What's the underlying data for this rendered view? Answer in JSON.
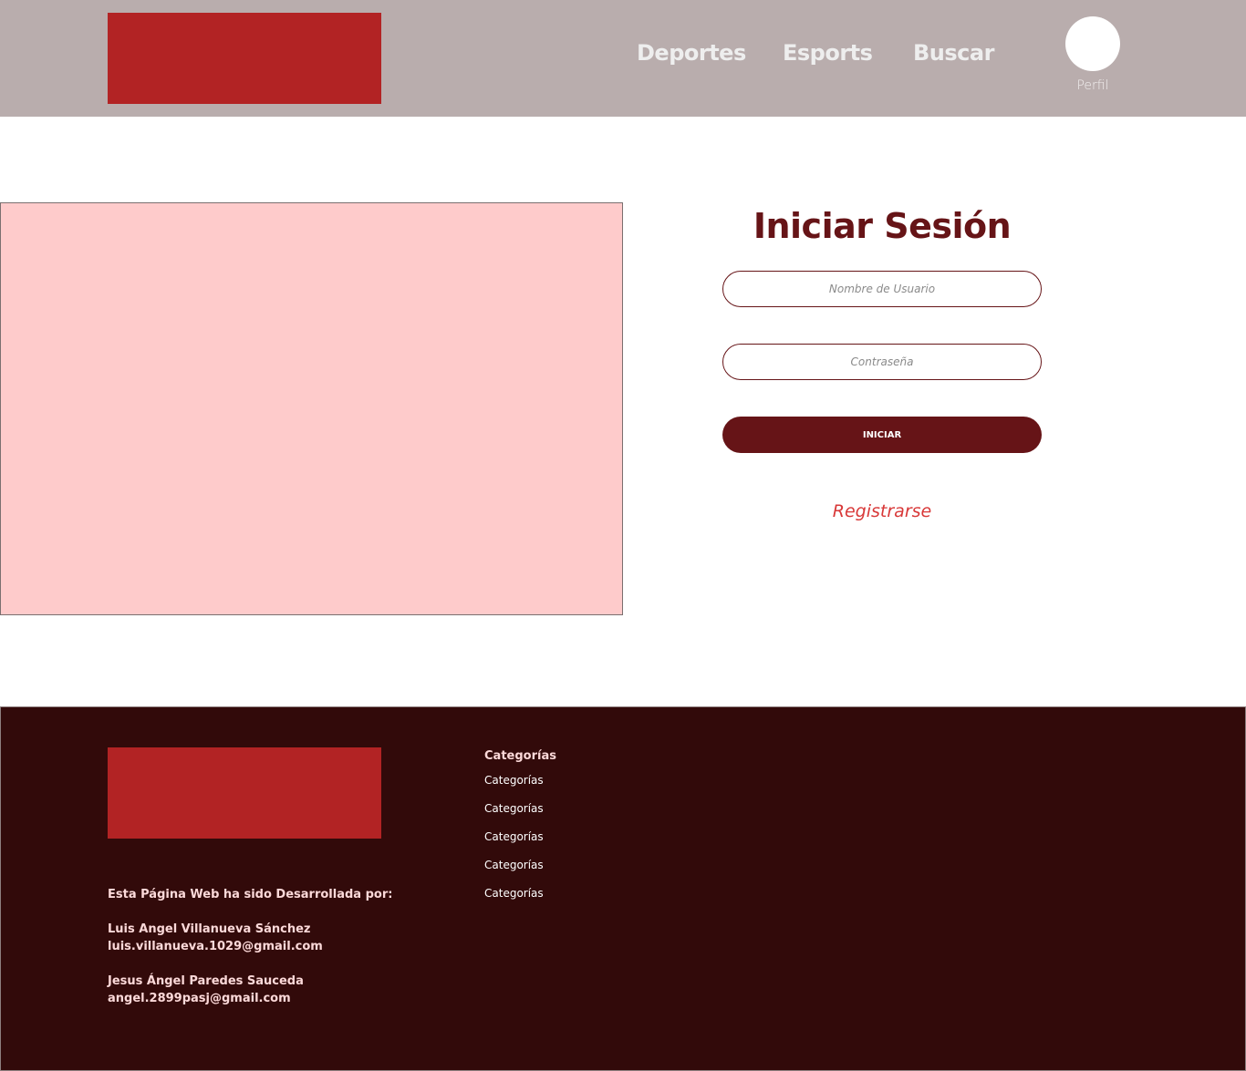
{
  "header": {
    "nav": [
      {
        "label": "Deportes"
      },
      {
        "label": "Esports"
      },
      {
        "label": "Buscar"
      }
    ],
    "profile_label": "Perfil"
  },
  "login": {
    "title": "Iniciar Sesión",
    "username_placeholder": "Nombre de Usuario",
    "password_placeholder": "Contraseña",
    "submit_label": "INICIAR",
    "register_label": "Registrarse"
  },
  "footer": {
    "credits_heading": "Esta Página Web ha sido Desarrollada por:",
    "authors": [
      {
        "name": "Luis Angel Villanueva Sánchez",
        "email": "luis.villanueva.1029@gmail.com"
      },
      {
        "name": "Jesus Ángel Paredes Sauceda",
        "email": "angel.2899pasj@gmail.com"
      }
    ],
    "categories_title": "Categorías",
    "categories": [
      {
        "label": "Categorías"
      },
      {
        "label": "Categorías"
      },
      {
        "label": "Categorías"
      },
      {
        "label": "Categorías"
      },
      {
        "label": "Categorías"
      }
    ]
  },
  "colors": {
    "header_bg": "#b9adad",
    "logo_red": "#b22324",
    "primary": "#661417",
    "hero_placeholder": "#fecbcb",
    "register_link": "#d83838",
    "footer_bg": "#320a0a"
  },
  "icons": {
    "profile": "avatar-circle"
  }
}
